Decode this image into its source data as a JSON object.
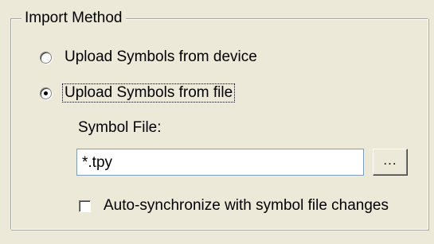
{
  "import_method": {
    "title": "Import Method",
    "options": [
      {
        "label": "Upload Symbols from device",
        "selected": false
      },
      {
        "label": "Upload Symbols from file",
        "selected": true
      }
    ],
    "symbol_file": {
      "label": "Symbol File:",
      "value": "*.tpy",
      "browse_label": "..."
    },
    "auto_sync": {
      "label": "Auto-synchronize with symbol file changes",
      "checked": false
    }
  }
}
